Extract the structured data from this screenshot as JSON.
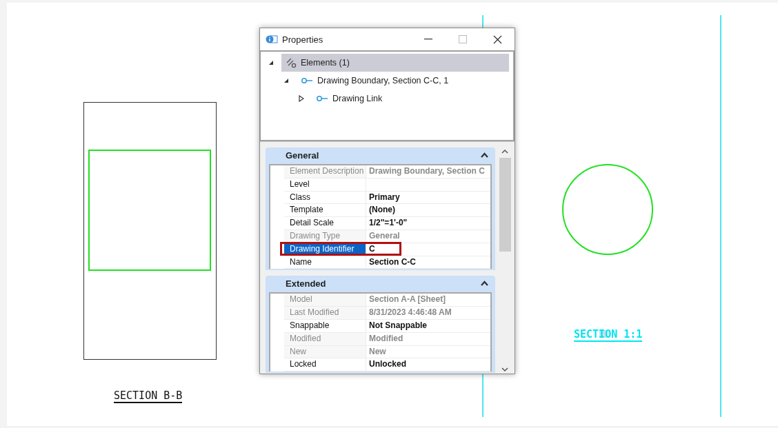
{
  "canvas": {
    "labels": [
      {
        "text": "SECTION B-B",
        "kind": "black"
      },
      {
        "text": "SECTION 1:1",
        "kind": "cyan"
      }
    ]
  },
  "window": {
    "title": "Properties"
  },
  "tree": [
    {
      "label": "Elements (1)",
      "kind": "elements",
      "selected": true,
      "expanded": true,
      "children": [
        {
          "label": "Drawing Boundary, Section C-C, 1",
          "kind": "link",
          "selected": false,
          "expanded": true,
          "children": [
            {
              "label": "Drawing Link",
              "kind": "link",
              "selected": false,
              "expanded": false
            }
          ]
        }
      ]
    }
  ],
  "sections": [
    {
      "title": "General",
      "expanded": true,
      "rows": [
        {
          "label": "Element Description",
          "value": "Drawing Boundary, Section C",
          "disabled": true,
          "selected": false
        },
        {
          "label": "Level",
          "value": "",
          "disabled": false,
          "selected": false
        },
        {
          "label": "Class",
          "value": "Primary",
          "disabled": false,
          "selected": false
        },
        {
          "label": "Template",
          "value": "(None)",
          "disabled": false,
          "selected": false
        },
        {
          "label": "Detail Scale",
          "value": "1/2\"=1'-0\"",
          "disabled": false,
          "selected": false
        },
        {
          "label": "Drawing Type",
          "value": "General",
          "disabled": true,
          "selected": false
        },
        {
          "label": "Drawing Identifier",
          "value": "C",
          "disabled": false,
          "selected": true
        },
        {
          "label": "Name",
          "value": "Section C-C",
          "disabled": false,
          "selected": false
        }
      ]
    },
    {
      "title": "Extended",
      "expanded": true,
      "rows": [
        {
          "label": "Model",
          "value": "Section A-A [Sheet]",
          "disabled": true,
          "selected": false
        },
        {
          "label": "Last Modified",
          "value": "8/31/2023 4:46:48 AM",
          "disabled": true,
          "selected": false
        },
        {
          "label": "Snappable",
          "value": "Not Snappable",
          "disabled": false,
          "selected": false
        },
        {
          "label": "Modified",
          "value": "Modified",
          "disabled": true,
          "selected": false
        },
        {
          "label": "New",
          "value": "New",
          "disabled": true,
          "selected": false
        },
        {
          "label": "Locked",
          "value": "Unlocked",
          "disabled": false,
          "selected": false
        }
      ]
    }
  ]
}
